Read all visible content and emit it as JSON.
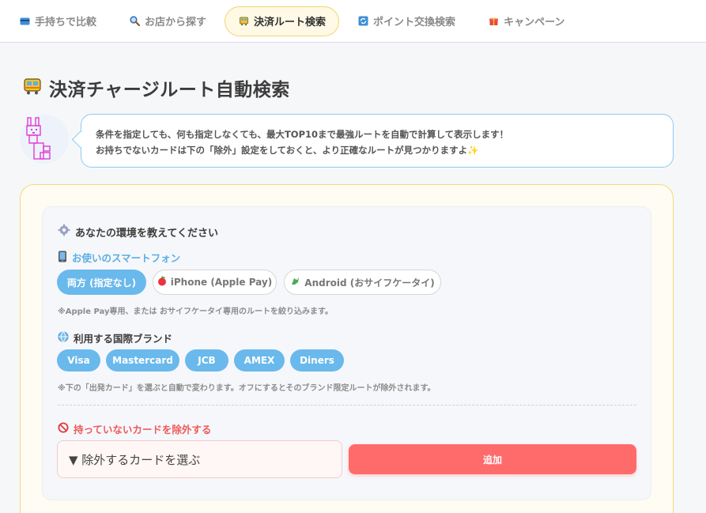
{
  "nav": {
    "tabs": [
      {
        "label": "手持ちで比較",
        "icon": "credit-card-icon",
        "active": false
      },
      {
        "label": "お店から探す",
        "icon": "magnifier-icon",
        "active": false
      },
      {
        "label": "決済ルート検索",
        "icon": "tram-icon",
        "active": true
      },
      {
        "label": "ポイント交換検索",
        "icon": "refresh-icon",
        "active": false
      },
      {
        "label": "キャンペーン",
        "icon": "gift-icon",
        "active": false
      }
    ]
  },
  "page": {
    "title": "決済チャージルート自動検索",
    "title_icon": "tram-icon"
  },
  "intro": {
    "line1": "条件を指定しても、何も指定しなくても、最大TOP10まで最強ルートを自動で計算して表示します！",
    "line2": "お持ちでないカードは下の「除外」設定をしておくと、より正確なルートが見つかりますよ",
    "sparkle": "✨"
  },
  "env": {
    "title": "あなたの環境を教えてください",
    "icon": "gear-icon",
    "phone": {
      "label": "お使いのスマートフォン",
      "icon": "smartphone-icon",
      "options": [
        {
          "label": "両方 (指定なし)",
          "selected": true
        },
        {
          "label": "iPhone (Apple Pay)",
          "icon": "apple-icon",
          "selected": false
        },
        {
          "label": "Android (おサイフケータイ)",
          "icon": "android-icon",
          "selected": false
        }
      ],
      "note": "※Apple Pay専用、または おサイフケータイ専用のルートを絞り込みます。"
    },
    "brands": {
      "label": "利用する国際ブランド",
      "icon": "globe-icon",
      "items": [
        "Visa",
        "Mastercard",
        "JCB",
        "AMEX",
        "Diners"
      ],
      "note": "※下の「出発カード」を選ぶと自動で変わります。オフにするとそのブランド限定ルートが除外されます。"
    }
  },
  "exclude": {
    "title": "持っていないカードを除外する",
    "icon": "prohibited-icon",
    "select_label": "▼ 除外するカードを選ぶ",
    "add_label": "追加"
  },
  "colors": {
    "accent_blue": "#6ab9ec",
    "accent_red": "#ff6b6b",
    "accent_yellow": "#f3d36b",
    "bubble_border": "#8ecbf0"
  }
}
